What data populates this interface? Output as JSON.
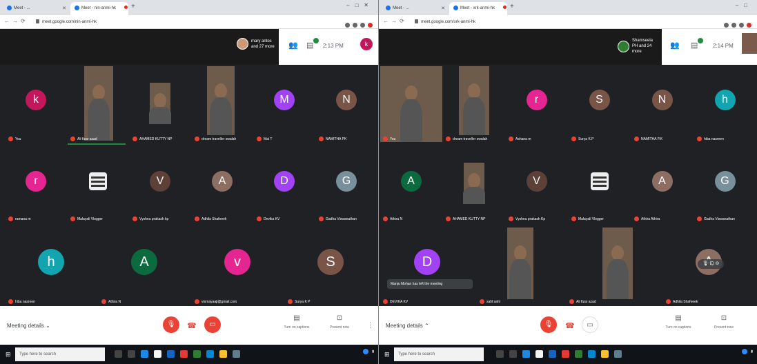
{
  "colors": {
    "meet_bg": "#202124",
    "muted_red": "#ea4335",
    "speaking_green": "#1e8e3e",
    "pink": "#e52592",
    "purple": "#a142f4",
    "brown": "#795548",
    "teal": "#12a4af",
    "green": "#0b6b3f",
    "grey": "#78909c"
  },
  "left": {
    "tabs": [
      "Meet - ...",
      "Meet - nin-anmi-hk"
    ],
    "url": "meet.google.com/nin-anmi-hk",
    "participants_chip": "mary antos and 27 more",
    "time": "2:13 PM",
    "self_initial": "k",
    "tiles": [
      {
        "kind": "avatar",
        "initial": "k",
        "color": "#c2185b",
        "name": "You"
      },
      {
        "kind": "photo",
        "name": "Ali fizar azad",
        "speaking": true
      },
      {
        "kind": "photo",
        "name": "AHAMED KUTTY NP"
      },
      {
        "kind": "photo",
        "name": "dream traveller swalah"
      },
      {
        "kind": "avatar",
        "initial": "M",
        "color": "#a142f4",
        "name": "Mai T"
      },
      {
        "kind": "avatar",
        "initial": "N",
        "color": "#795548",
        "name": "NAMITHA PK"
      },
      {
        "kind": "avatar",
        "initial": "r",
        "color": "#e52592",
        "name": "ramana m"
      },
      {
        "kind": "logo",
        "name": "Malayali Vlogger"
      },
      {
        "kind": "avatar",
        "initial": "V",
        "color": "#5d4037",
        "name": "Vyshnu prakash kp"
      },
      {
        "kind": "avatar",
        "initial": "A",
        "color": "#8d6e63",
        "name": "Adhila Shafeeek"
      },
      {
        "kind": "avatar",
        "initial": "D",
        "color": "#a142f4",
        "name": "Devika KV"
      },
      {
        "kind": "avatar",
        "initial": "G",
        "color": "#78909c",
        "name": "Gadha Viswanathan"
      },
      {
        "kind": "avatar",
        "initial": "h",
        "color": "#12a4af",
        "name": "hiba nasreen"
      },
      {
        "kind": "avatar",
        "initial": "A",
        "color": "#0b6b3f",
        "name": "Athira N"
      },
      {
        "kind": "avatar",
        "initial": "v",
        "color": "#e52592",
        "name": "vismayaaji@gmail.com"
      },
      {
        "kind": "avatar",
        "initial": "S",
        "color": "#795548",
        "name": "Surya K P"
      }
    ],
    "meeting_details": "Meeting details",
    "turn_on_captions": "Turn on captions",
    "present_now": "Present now",
    "search_placeholder": "Type here to search"
  },
  "right": {
    "tabs": [
      "Meet - ...",
      "Meet - xrk-anmi-hk"
    ],
    "url": "meet.google.com/xrk-anmi-hk",
    "participants_chip": "Shamseela PH and 24 more",
    "time": "2:14 PM",
    "tiles": [
      {
        "kind": "photo",
        "name": "You"
      },
      {
        "kind": "photo",
        "name": "dream traveller swalah"
      },
      {
        "kind": "avatar",
        "initial": "r",
        "color": "#e52592",
        "name": "Ashana m"
      },
      {
        "kind": "avatar",
        "initial": "S",
        "color": "#795548",
        "name": "Surya K.P"
      },
      {
        "kind": "avatar",
        "initial": "N",
        "color": "#795548",
        "name": "NAMITHA P.K"
      },
      {
        "kind": "avatar",
        "initial": "h",
        "color": "#12a4af",
        "name": "hiba nasreen"
      },
      {
        "kind": "avatar",
        "initial": "A",
        "color": "#0b6b3f",
        "name": "Athira N"
      },
      {
        "kind": "photo",
        "name": "AHAMED KUTTY NP"
      },
      {
        "kind": "avatar",
        "initial": "V",
        "color": "#5d4037",
        "name": "Vyshnu prakash Kp"
      },
      {
        "kind": "logo",
        "name": "Malayali Vlogger"
      },
      {
        "kind": "avatar",
        "initial": "A",
        "color": "#8d6e63",
        "name": "Athira Athira"
      },
      {
        "kind": "avatar",
        "initial": "G",
        "color": "#78909c",
        "name": "Gadha Viswanathan"
      },
      {
        "kind": "avatar",
        "initial": "D",
        "color": "#a142f4",
        "name": "DEVIKA KV"
      },
      {
        "kind": "photo",
        "name": "sahl sahl"
      },
      {
        "kind": "photo",
        "name": "Ali fizar azad"
      },
      {
        "kind": "avatar",
        "initial": "A",
        "color": "#8d6e63",
        "name": "Adhila Shafeeek"
      }
    ],
    "toast": "Manju Mohan has left the meeting",
    "meeting_details": "Meeting details",
    "turn_on_captions": "Turn on captions",
    "present_now": "Present now",
    "search_placeholder": "Type here to search"
  }
}
